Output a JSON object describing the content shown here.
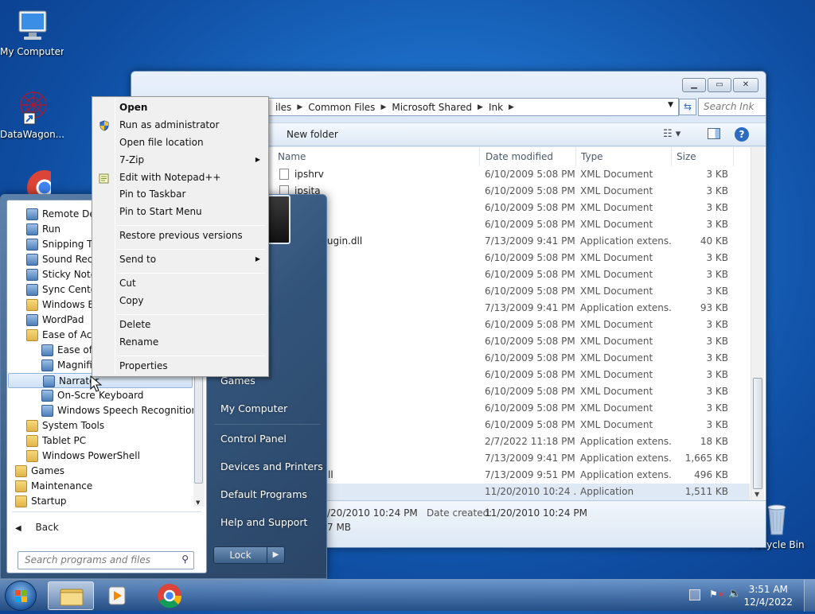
{
  "desktop": {
    "icons": [
      {
        "label": "My Computer",
        "icon": "computer-icon"
      },
      {
        "label": "DataWagon...",
        "icon": "datawagon-icon"
      },
      {
        "label": "Recycle Bin",
        "icon": "recycle-bin-icon"
      }
    ]
  },
  "explorer": {
    "breadcrumb": [
      "iles",
      "Common Files",
      "Microsoft Shared",
      "Ink"
    ],
    "search_placeholder": "Search Ink",
    "toolbar": {
      "new_folder": "New folder"
    },
    "columns": [
      "Name",
      "Date modified",
      "Type",
      "Size"
    ],
    "rows": [
      {
        "name": "ipshrv",
        "date": "6/10/2009 5:08 PM",
        "type": "XML Document",
        "size": "3 KB"
      },
      {
        "name": "ipsita",
        "date": "6/10/2009 5:08 PM",
        "type": "XML Document",
        "size": "3 KB"
      },
      {
        "name": "",
        "date": "6/10/2009 5:08 PM",
        "type": "XML Document",
        "size": "3 KB"
      },
      {
        "name": "",
        "date": "6/10/2009 5:08 PM",
        "type": "XML Document",
        "size": "3 KB"
      },
      {
        "name": "ationPlugin.dll",
        "date": "7/13/2009 9:41 PM",
        "type": "Application extens...",
        "size": "40 KB"
      },
      {
        "name": "",
        "date": "6/10/2009 5:08 PM",
        "type": "XML Document",
        "size": "3 KB"
      },
      {
        "name": "",
        "date": "6/10/2009 5:08 PM",
        "type": "XML Document",
        "size": "3 KB"
      },
      {
        "name": "",
        "date": "6/10/2009 5:08 PM",
        "type": "XML Document",
        "size": "3 KB"
      },
      {
        "name": "n.dll",
        "date": "7/13/2009 9:41 PM",
        "type": "Application extens...",
        "size": "93 KB"
      },
      {
        "name": "",
        "date": "6/10/2009 5:08 PM",
        "type": "XML Document",
        "size": "3 KB"
      },
      {
        "name": "",
        "date": "6/10/2009 5:08 PM",
        "type": "XML Document",
        "size": "3 KB"
      },
      {
        "name": "",
        "date": "6/10/2009 5:08 PM",
        "type": "XML Document",
        "size": "3 KB"
      },
      {
        "name": "",
        "date": "6/10/2009 5:08 PM",
        "type": "XML Document",
        "size": "3 KB"
      },
      {
        "name": "",
        "date": "6/10/2009 5:08 PM",
        "type": "XML Document",
        "size": "3 KB"
      },
      {
        "name": "",
        "date": "6/10/2009 5:08 PM",
        "type": "XML Document",
        "size": "3 KB"
      },
      {
        "name": "",
        "date": "6/10/2009 5:08 PM",
        "type": "XML Document",
        "size": "3 KB"
      },
      {
        "name": "dll",
        "date": "2/7/2022 11:18 PM",
        "type": "Application extens...",
        "size": "18 KB"
      },
      {
        "name": "dll",
        "date": "7/13/2009 9:41 PM",
        "type": "Application extens...",
        "size": "1,665 KB"
      },
      {
        "name": "ft.Ink.dll",
        "date": "7/13/2009 9:51 PM",
        "type": "Application extens...",
        "size": "496 KB"
      },
      {
        "name": "",
        "date": "11/20/2010 10:24 ...",
        "type": "Application",
        "size": "1,511 KB"
      }
    ],
    "details": {
      "modified": "/20/2010 10:24 PM",
      "created_label": "Date created:",
      "created": "11/20/2010 10:24 PM",
      "size": "7 MB"
    }
  },
  "start_menu": {
    "programs": [
      {
        "label": "Remote Des",
        "icon": "remote-desktop-icon",
        "indent": 1
      },
      {
        "label": "Run",
        "icon": "run-icon",
        "indent": 1
      },
      {
        "label": "Snipping To",
        "icon": "scissors-icon",
        "indent": 1
      },
      {
        "label": "Sound Reco",
        "icon": "microphone-icon",
        "indent": 1
      },
      {
        "label": "Sticky Notes",
        "icon": "sticky-note-icon",
        "indent": 1
      },
      {
        "label": "Sync Center",
        "icon": "sync-icon",
        "indent": 1
      },
      {
        "label": "Windows Ex",
        "icon": "folder-icon",
        "indent": 1
      },
      {
        "label": "WordPad",
        "icon": "wordpad-icon",
        "indent": 1
      },
      {
        "label": "Ease of Acc",
        "icon": "folder-icon",
        "indent": 1
      },
      {
        "label": "Ease of A",
        "icon": "ease-of-access-icon",
        "indent": 2
      },
      {
        "label": "Magnifie",
        "icon": "magnifier-icon",
        "indent": 2
      },
      {
        "label": "Narrator",
        "icon": "narrator-icon",
        "indent": 2,
        "highlighted": true
      },
      {
        "label": "On-Scre",
        "icon": "keyboard-icon",
        "indent": 2
      },
      {
        "label": "Windows Speech Recognition",
        "icon": "microphone-icon",
        "indent": 2
      },
      {
        "label": "System Tools",
        "icon": "folder-icon",
        "indent": 1
      },
      {
        "label": "Tablet PC",
        "icon": "folder-icon",
        "indent": 1
      },
      {
        "label": "Windows PowerShell",
        "icon": "folder-icon",
        "indent": 1
      },
      {
        "label": "Games",
        "icon": "folder-icon",
        "indent": 0
      },
      {
        "label": "Maintenance",
        "icon": "folder-icon",
        "indent": 0
      },
      {
        "label": "Startup",
        "icon": "folder-icon",
        "indent": 0
      }
    ],
    "on_screen_keyboard_tail": " Keyboard",
    "back_label": "Back",
    "search_placeholder": "Search programs and files",
    "right_items": [
      "Games",
      "My Computer",
      "Control Panel",
      "Devices and Printers",
      "Default Programs",
      "Help and Support"
    ],
    "lock_label": "Lock"
  },
  "context_menu": {
    "items": [
      {
        "label": "Open",
        "bold": true
      },
      {
        "label": "Run as administrator",
        "icon": "shield-icon"
      },
      {
        "label": "Open file location"
      },
      {
        "label": "7-Zip",
        "submenu": true
      },
      {
        "label": "Edit with Notepad++",
        "icon": "notepad-plus-icon"
      },
      {
        "label": "Pin to Taskbar"
      },
      {
        "label": "Pin to Start Menu"
      },
      {
        "label": "Restore previous versions"
      },
      {
        "label": "Send to",
        "submenu": true
      },
      {
        "label": "Cut"
      },
      {
        "label": "Copy"
      },
      {
        "label": "Delete"
      },
      {
        "label": "Rename"
      },
      {
        "label": "Properties"
      }
    ]
  },
  "taskbar": {
    "time": "3:51 AM",
    "date": "12/4/2022"
  }
}
